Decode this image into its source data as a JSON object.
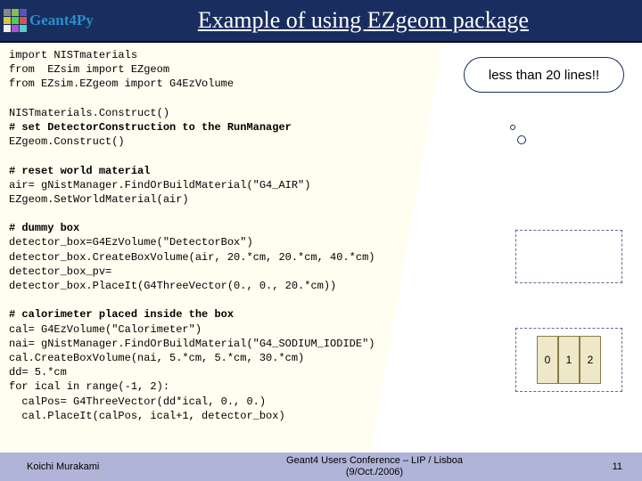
{
  "header": {
    "logo_text": "Geant4Py",
    "title": "Example of using EZgeom package"
  },
  "callout": "less than 20 lines!!",
  "diagram2": {
    "cells": [
      "0",
      "1",
      "2"
    ]
  },
  "code": {
    "l1": "import NISTmaterials",
    "l2": "from  EZsim import EZgeom",
    "l3": "from EZsim.EZgeom import G4EzVolume",
    "l4": "",
    "l5": "NISTmaterials.Construct()",
    "l6": "# set DetectorConstruction to the RunManager",
    "l7": "EZgeom.Construct()",
    "l8": "",
    "l9": "# reset world material",
    "l10": "air= gNistManager.FindOrBuildMaterial(\"G4_AIR\")",
    "l11": "EZgeom.SetWorldMaterial(air)",
    "l12": "",
    "l13": "# dummy box",
    "l14": "detector_box=G4EzVolume(\"DetectorBox\")",
    "l15": "detector_box.CreateBoxVolume(air, 20.*cm, 20.*cm, 40.*cm)",
    "l16": "detector_box_pv=",
    "l17": "detector_box.PlaceIt(G4ThreeVector(0., 0., 20.*cm))",
    "l18": "",
    "l19": "# calorimeter placed inside the box",
    "l20": "cal= G4EzVolume(\"Calorimeter\")",
    "l21": "nai= gNistManager.FindOrBuildMaterial(\"G4_SODIUM_IODIDE\")",
    "l22": "cal.CreateBoxVolume(nai, 5.*cm, 5.*cm, 30.*cm)",
    "l23": "dd= 5.*cm",
    "l24": "for ical in range(-1, 2):",
    "l25": "  calPos= G4ThreeVector(dd*ical, 0., 0.)",
    "l26": "  cal.PlaceIt(calPos, ical+1, detector_box)"
  },
  "footer": {
    "left": "Koichi Murakami",
    "center_l1": "Geant4 Users Conference – LIP / Lisboa",
    "center_l2": "(9/Oct./2006)",
    "right": "11"
  }
}
